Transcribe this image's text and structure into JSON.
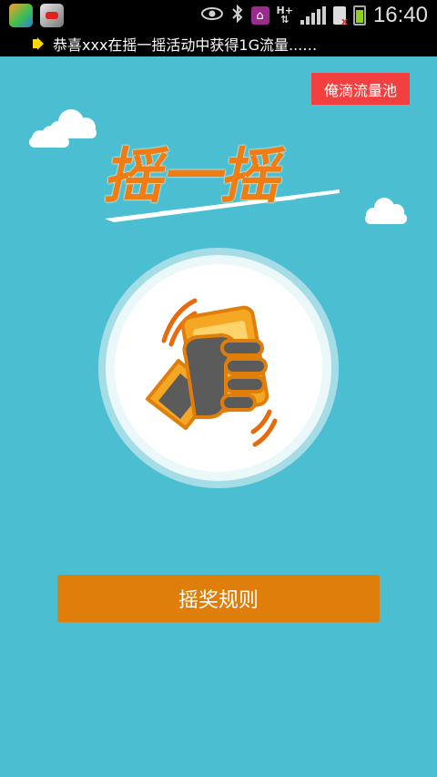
{
  "status_bar": {
    "time": "16:40",
    "network_label": "H+",
    "icons": [
      "app-icon",
      "app-icon",
      "eye-icon",
      "bluetooth-icon",
      "home-icon",
      "hplus-icon",
      "signal-icon",
      "sim-icon",
      "battery-icon"
    ]
  },
  "notice": {
    "text": "恭喜xxx在摇一摇活动中获得1G流量...…",
    "icon": "speaker-icon"
  },
  "header": {
    "pool_button_label": "俺滴流量池"
  },
  "hero": {
    "title": "摇一摇"
  },
  "actions": {
    "rules_button_label": "摇奖规则"
  },
  "colors": {
    "background": "#4bbfd1",
    "accent_orange": "#e07e0c",
    "title_orange": "#ef7d14",
    "pool_red": "#f24040"
  }
}
